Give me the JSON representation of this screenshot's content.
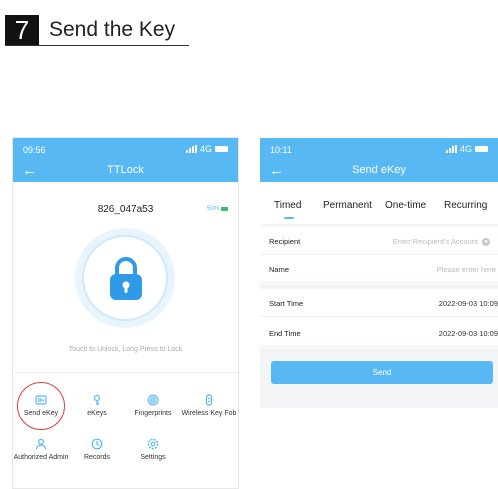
{
  "step": {
    "number": "7",
    "title": "Send the Key"
  },
  "left_phone": {
    "status_time": "09:56",
    "status_network": "4G",
    "nav_title": "TTLock",
    "back_symbol": "←",
    "lock_name": "826_047a53",
    "battery_level": "50%",
    "touch_hint": "Touch to Unlock, Long Press to Lock",
    "menu": [
      {
        "label": "Send eKey",
        "icon": "send-ekey-icon"
      },
      {
        "label": "eKeys",
        "icon": "ekeys-icon"
      },
      {
        "label": "Fingerprints",
        "icon": "fingerprint-icon"
      },
      {
        "label": "Wireless Key Fob",
        "icon": "key-fob-icon"
      },
      {
        "label": "Authorized Admin",
        "icon": "admin-user-icon"
      },
      {
        "label": "Records",
        "icon": "records-icon"
      },
      {
        "label": "Settings",
        "icon": "settings-gear-icon"
      }
    ],
    "accent_color": "#58b8f4",
    "highlight_color": "#e23b3b"
  },
  "right_phone": {
    "status_time": "10:11",
    "status_network": "4G",
    "nav_title": "Send eKey",
    "back_symbol": "←",
    "tabs": [
      "Timed",
      "Permanent",
      "One-time",
      "Recurring"
    ],
    "active_tab": "Timed",
    "recipient_label": "Recipient",
    "recipient_placeholder": "Enter Recipient's Account",
    "name_label": "Name",
    "name_placeholder": "Please enter here",
    "start_label": "Start Time",
    "start_value": "2022-09-03 10:09",
    "end_label": "End Time",
    "end_value": "2022-09-03 10:09",
    "send_label": "Send"
  }
}
